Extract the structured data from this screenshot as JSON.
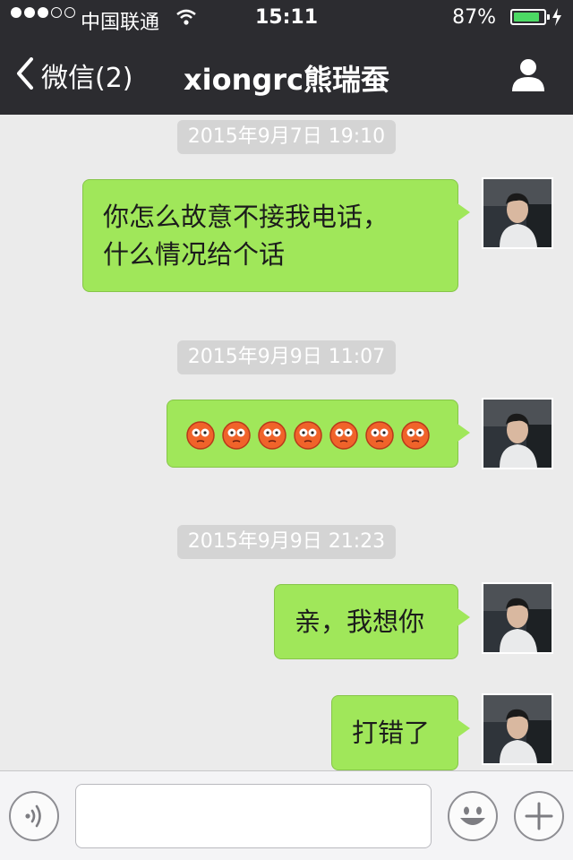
{
  "status_bar": {
    "carrier": "中国联通",
    "time": "15:11",
    "battery_percent": "87%",
    "battery_level": 0.87,
    "signal_bars": 3,
    "signal_total": 5
  },
  "nav": {
    "back_label": "微信(2)",
    "title": "xiongrc熊瑞蚕",
    "profile_icon": "person-icon"
  },
  "messages": [
    {
      "timestamp": "2015年9月7日 19:10",
      "text": "你怎么故意不接我电话，\n什么情况给个话",
      "sender": "me"
    },
    {
      "timestamp": "2015年9月9日 11:07",
      "emoji": "flushed-face-emoji",
      "emoji_count": 7,
      "sender": "me"
    },
    {
      "timestamp": "2015年9月9日 21:23",
      "text": "亲，我想你",
      "sender": "me"
    },
    {
      "text": "打错了",
      "sender": "me"
    }
  ],
  "input_bar": {
    "voice_icon": "voice-icon",
    "message_value": "",
    "emoji_icon": "smiley-icon",
    "more_icon": "plus-icon"
  },
  "colors": {
    "nav_bg": "#2c2c30",
    "chat_bg": "#ebebeb",
    "bubble_green": "#a0e75a",
    "timestamp_bg": "#d4d4d4"
  }
}
